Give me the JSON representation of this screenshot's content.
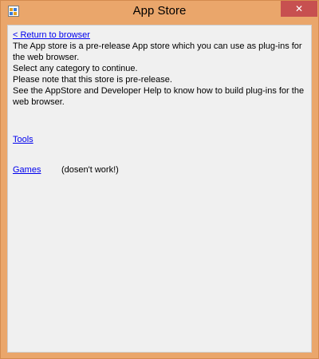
{
  "window": {
    "title": "App Store",
    "close_label": "✕"
  },
  "content": {
    "return_link": "< Return to browser",
    "description_lines": [
      "The App store is a pre-release App store which you can use as plug-ins for",
      "the web browser.",
      "Select any category to continue.",
      "Please note that this store is pre-release.",
      "See the AppStore and Developer Help to know how to build plug-ins for the",
      "web browser."
    ]
  },
  "categories": {
    "tools_label": "Tools",
    "games_label": "Games",
    "games_note": "(dosen't work!)"
  },
  "colors": {
    "window_frame": "#eaa66b",
    "close_button": "#c75050",
    "link": "#0000ee",
    "client_background": "#f0f0f0"
  }
}
